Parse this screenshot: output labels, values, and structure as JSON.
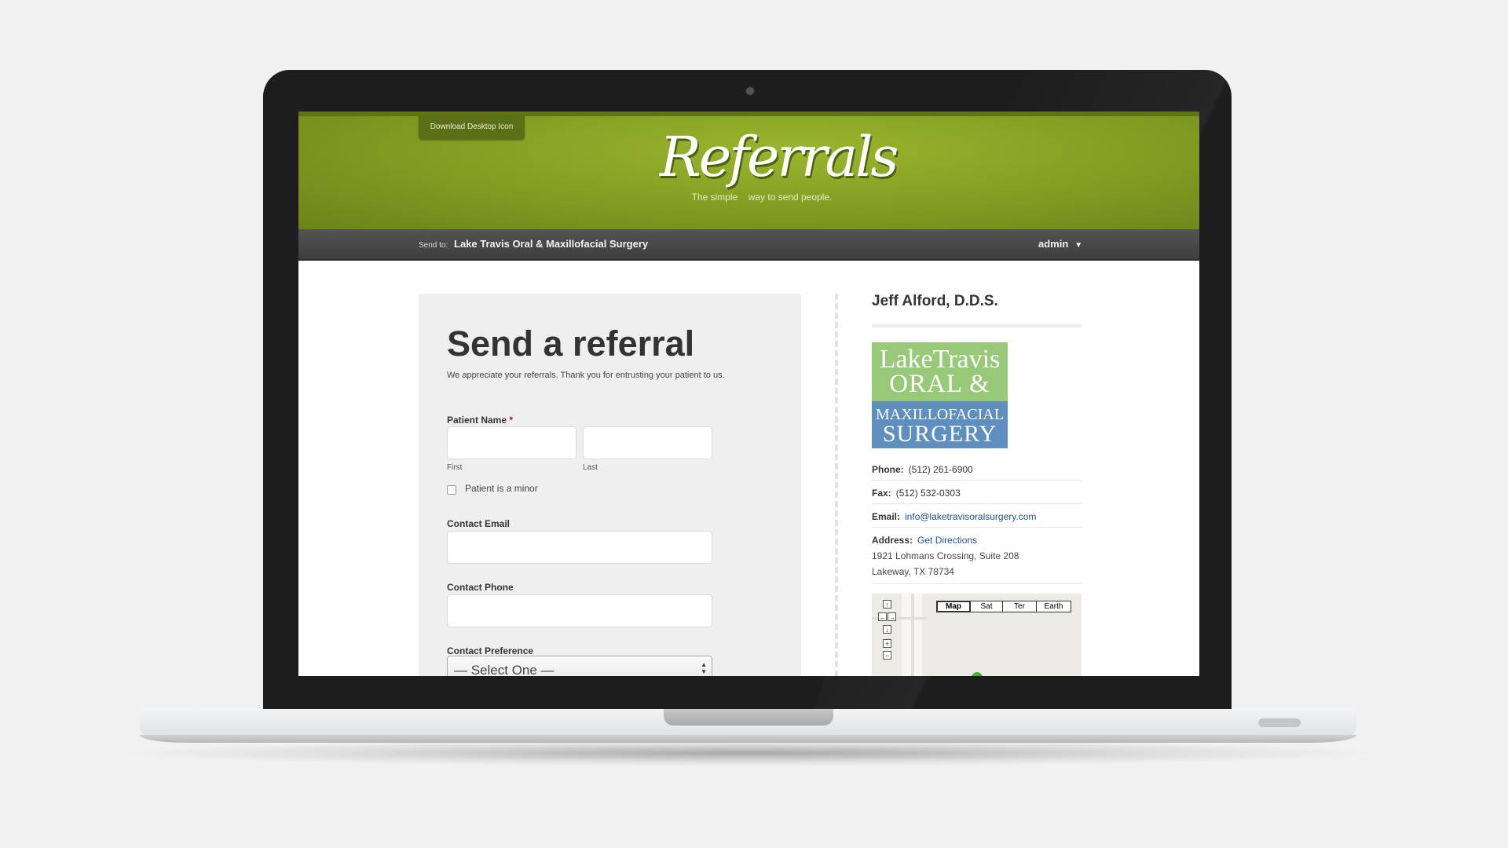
{
  "header": {
    "download_tab": "Download Desktop Icon",
    "logo_text": "Referrals",
    "tagline": "The simple    way to send people."
  },
  "nav": {
    "send_to_label": "Send to:",
    "send_to_value": "Lake Travis Oral & Maxillofacial Surgery",
    "user": "admin",
    "user_caret": "▼"
  },
  "form": {
    "title": "Send a referral",
    "intro": "We appreciate your referrals. Thank you for entrusting your patient to us.",
    "patient_name_label": "Patient Name",
    "required_marker": "*",
    "first_sublabel": "First",
    "last_sublabel": "Last",
    "first_value": "",
    "last_value": "",
    "minor_label": "Patient is a minor",
    "minor_checked": false,
    "email_label": "Contact Email",
    "email_value": "",
    "phone_label": "Contact Phone",
    "phone_value": "",
    "preference_label": "Contact Preference",
    "preference_selected": "— Select One —"
  },
  "practice": {
    "doctor": "Jeff Alford, D.D.S.",
    "logo": {
      "line1": "LakeTravis",
      "line2": "ORAL &",
      "line3": "MAXILLOFACIAL",
      "line4": "SURGERY"
    },
    "phone_label": "Phone:",
    "phone": "(512) 261-6900",
    "fax_label": "Fax:",
    "fax": "(512) 532-0303",
    "email_label": "Email:",
    "email": "info@laketravisoralsurgery.com",
    "address_label": "Address:",
    "directions_link": "Get Directions",
    "address_line1": "1921 Lohmans Crossing, Suite 208",
    "address_line2": "Lakeway, TX 78734"
  },
  "map": {
    "types": [
      "Map",
      "Sat",
      "Ter",
      "Earth"
    ],
    "active_type": "Map",
    "pan_up": "↑",
    "pan_left": "←",
    "pan_right": "→",
    "pan_down": "↓",
    "zoom_in": "+",
    "zoom_out": "−"
  },
  "colors": {
    "header_green": "#8aa628",
    "nav_dark": "#474747",
    "logo_green": "#97c979",
    "logo_blue": "#5e8fbf",
    "link_blue": "#1f4f8a",
    "required_red": "#b0102c"
  }
}
